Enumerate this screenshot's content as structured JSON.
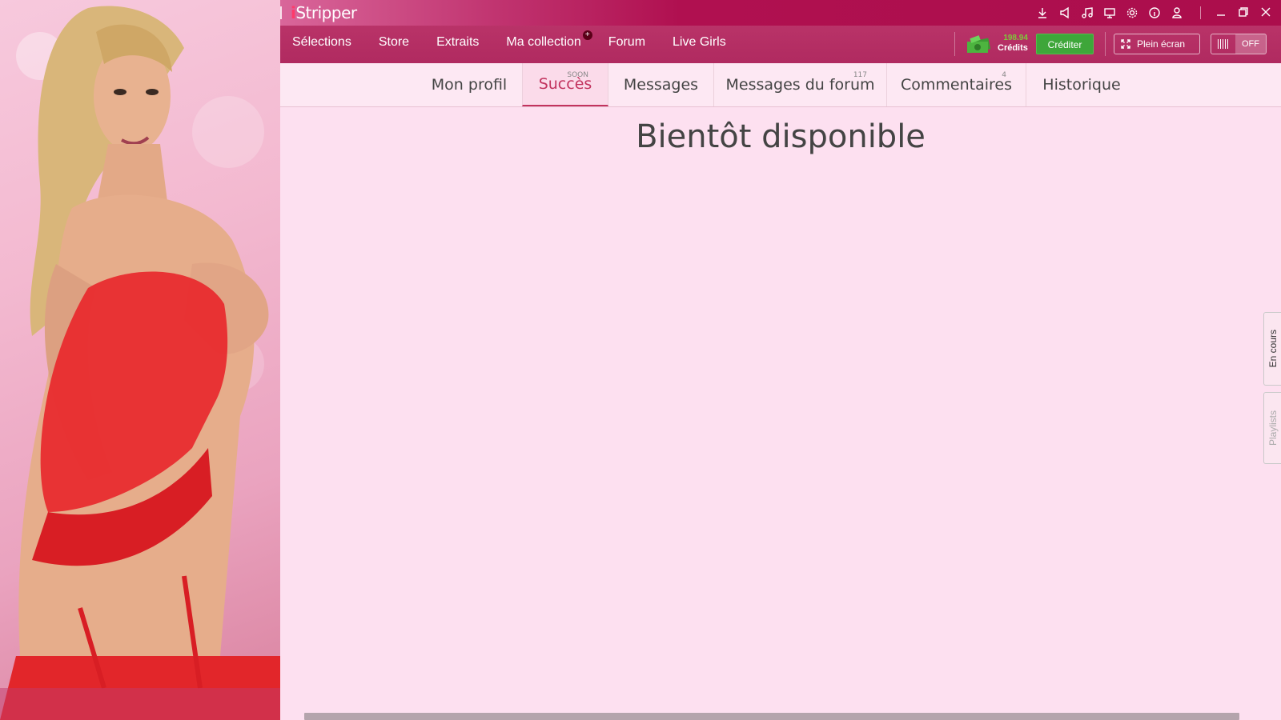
{
  "app": {
    "logo_i": "i",
    "logo_rest": "Stripper"
  },
  "titlebar": {
    "icons": [
      "download-icon",
      "announce-icon",
      "music-icon",
      "monitor-icon",
      "gear-icon",
      "info-icon",
      "user-icon"
    ],
    "window_buttons": [
      "minimize-icon",
      "restore-icon",
      "close-icon"
    ]
  },
  "nav": {
    "items": [
      {
        "label": "Sélections"
      },
      {
        "label": "Store"
      },
      {
        "label": "Extraits"
      },
      {
        "label": "Ma collection",
        "badge": "+"
      },
      {
        "label": "Forum"
      },
      {
        "label": "Live Girls"
      }
    ],
    "credits_amount": "198.94",
    "credits_label": "Crédits",
    "crediter_label": "Créditer",
    "fullscreen_label": "Plein écran",
    "toggle_label": "OFF"
  },
  "tabs": [
    {
      "label": "Mon profil",
      "sup": ""
    },
    {
      "label": "Succès",
      "sup": "SOON",
      "active": true
    },
    {
      "label": "Messages",
      "sup": ""
    },
    {
      "label": "Messages du forum",
      "sup": "117"
    },
    {
      "label": "Commentaires",
      "sup": "4"
    },
    {
      "label": "Historique",
      "sup": ""
    }
  ],
  "main": {
    "heading": "Bientôt disponible"
  },
  "side_tabs": {
    "encours": "En cours",
    "playlists": "Playlists"
  },
  "colors": {
    "brand": "#ab0e4c",
    "nav": "#b93368",
    "content_bg": "#fde0f0",
    "active_tab": "#c2335e",
    "credit_button": "#3ea63a"
  }
}
